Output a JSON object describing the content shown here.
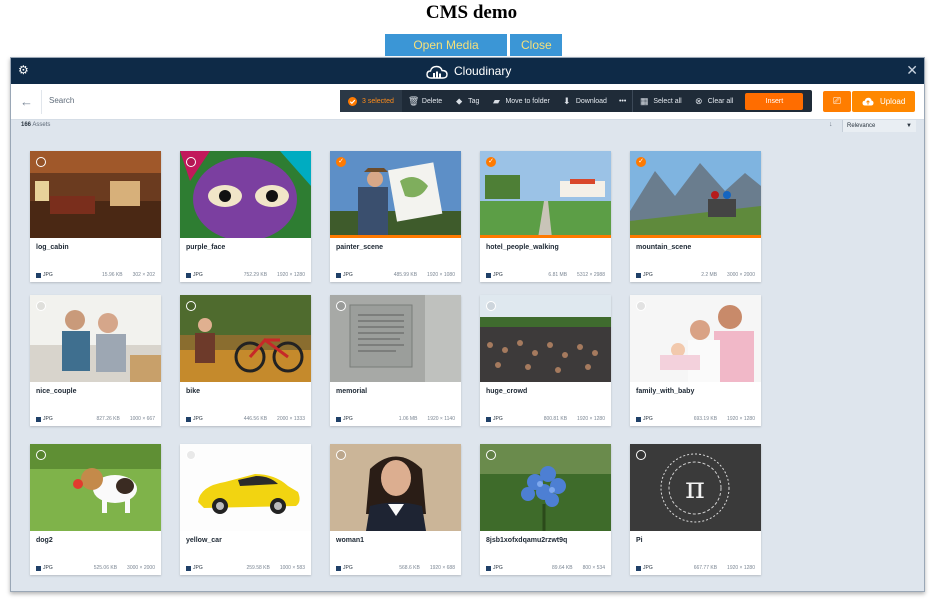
{
  "page": {
    "title": "CMS demo",
    "open_button": "Open Media Library",
    "close_button": "Close"
  },
  "widget": {
    "brand": "Cloudinary",
    "search_placeholder": "Search",
    "actions": {
      "selected": "3 selected",
      "delete": "Delete",
      "tag": "Tag",
      "move": "Move to folder",
      "download": "Download",
      "more": "•••",
      "select_all": "Select all",
      "clear_all": "Clear all",
      "insert": "Insert",
      "upload": "Upload"
    },
    "count": "166",
    "count_label": "Assets",
    "sort": "Relevance"
  },
  "colors": {
    "header": "#0e2a47",
    "accent": "#ff7a00",
    "action_bar": "#1f2b38",
    "top_button": "#3b96d6"
  },
  "assets": [
    {
      "name": "log_cabin",
      "format": "JPG",
      "size": "15.96 KB",
      "dims": "302 × 202",
      "selected": false,
      "thumb": "cabin"
    },
    {
      "name": "purple_face",
      "format": "JPG",
      "size": "752.29 KB",
      "dims": "1920 × 1280",
      "selected": false,
      "thumb": "face"
    },
    {
      "name": "painter_scene",
      "format": "JPG",
      "size": "485.99 KB",
      "dims": "1920 × 1080",
      "selected": true,
      "thumb": "painter"
    },
    {
      "name": "hotel_people_walking",
      "format": "JPG",
      "size": "6.81 MB",
      "dims": "5312 × 2988",
      "selected": true,
      "thumb": "hotel"
    },
    {
      "name": "mountain_scene",
      "format": "JPG",
      "size": "2.2 MB",
      "dims": "3000 × 2000",
      "selected": true,
      "thumb": "mountain"
    },
    {
      "name": "nice_couple",
      "format": "JPG",
      "size": "827.26 KB",
      "dims": "1000 × 667",
      "selected": false,
      "thumb": "couple"
    },
    {
      "name": "bike",
      "format": "JPG",
      "size": "446.56 KB",
      "dims": "2000 × 1333",
      "selected": false,
      "thumb": "bike"
    },
    {
      "name": "memorial",
      "format": "JPG",
      "size": "1.06 MB",
      "dims": "1920 × 1140",
      "selected": false,
      "thumb": "memorial"
    },
    {
      "name": "huge_crowd",
      "format": "JPG",
      "size": "800.81 KB",
      "dims": "1920 × 1280",
      "selected": false,
      "thumb": "crowd"
    },
    {
      "name": "family_with_baby",
      "format": "JPG",
      "size": "693.19 KB",
      "dims": "1920 × 1280",
      "selected": false,
      "thumb": "family"
    },
    {
      "name": "dog2",
      "format": "JPG",
      "size": "525.06 KB",
      "dims": "3000 × 2000",
      "selected": false,
      "thumb": "dog"
    },
    {
      "name": "yellow_car",
      "format": "JPG",
      "size": "259.58 KB",
      "dims": "1000 × 583",
      "selected": false,
      "thumb": "car"
    },
    {
      "name": "woman1",
      "format": "JPG",
      "size": "568.6 KB",
      "dims": "1920 × 688",
      "selected": false,
      "thumb": "woman"
    },
    {
      "name": "8jsb1xofxdqamu2rzwt9q",
      "format": "JPG",
      "size": "89.64 KB",
      "dims": "800 × 534",
      "selected": false,
      "thumb": "flower"
    },
    {
      "name": "Pi",
      "format": "JPG",
      "size": "667.77 KB",
      "dims": "1920 × 1280",
      "selected": false,
      "thumb": "pi"
    }
  ]
}
